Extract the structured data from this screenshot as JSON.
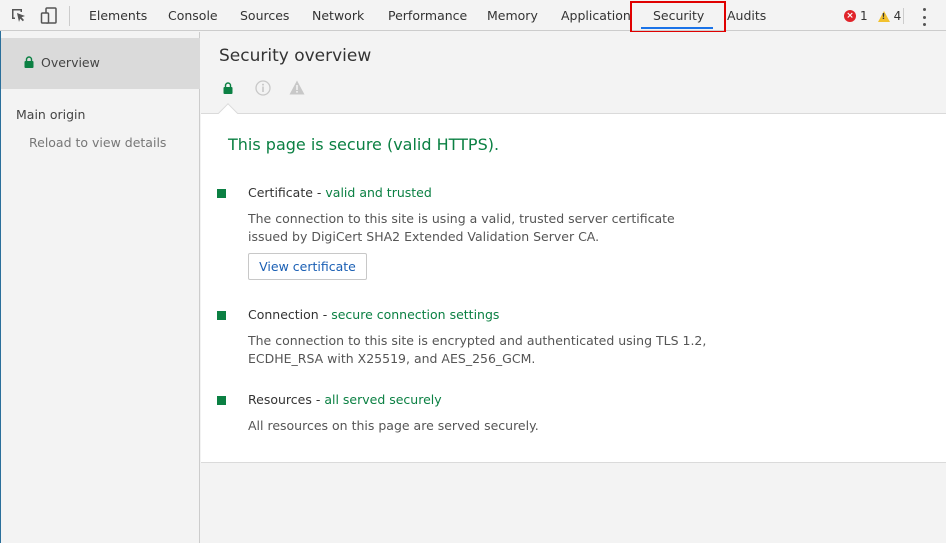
{
  "toolbar": {
    "tabs": [
      {
        "label": "Elements"
      },
      {
        "label": "Console"
      },
      {
        "label": "Sources"
      },
      {
        "label": "Network"
      },
      {
        "label": "Performance"
      },
      {
        "label": "Memory"
      },
      {
        "label": "Application"
      },
      {
        "label": "Security",
        "active": true
      },
      {
        "label": "Audits"
      }
    ],
    "error_count": "1",
    "warning_count": "4",
    "icons": [
      "inspect-element-icon",
      "device-toolbar-icon",
      "error-icon",
      "warning-icon",
      "more-menu-icon"
    ]
  },
  "sidebar": {
    "overview_label": "Overview",
    "main_origin_label": "Main origin",
    "reload_label": "Reload to view details"
  },
  "main": {
    "title": "Security overview",
    "summary_text": "This page is secure (valid HTTPS).",
    "sections": [
      {
        "title": "Certificate",
        "separator": " - ",
        "status": "valid and trusted",
        "description": "The connection to this site is using a valid, trusted server certificate issued by DigiCert SHA2 Extended Validation Server CA.",
        "button_label": "View certificate"
      },
      {
        "title": "Connection",
        "separator": " - ",
        "status": "secure connection settings",
        "description": "The connection to this site is encrypted and authenticated using TLS 1.2, ECDHE_RSA with X25519, and AES_256_GCM."
      },
      {
        "title": "Resources",
        "separator": " - ",
        "status": "all served securely",
        "description": "All resources on this page are served securely."
      }
    ]
  },
  "colors": {
    "secure_green": "#0b8043",
    "active_tab_underline": "#1a73e8",
    "highlight_box": "#e00000",
    "error_red": "#e0242a",
    "warning_yellow": "#f2c12e"
  }
}
